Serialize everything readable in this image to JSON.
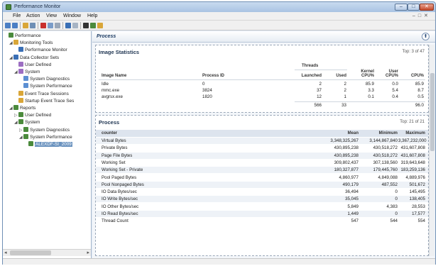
{
  "window": {
    "title": "Performance Monitor"
  },
  "menu": [
    "File",
    "Action",
    "View",
    "Window",
    "Help"
  ],
  "tree": [
    {
      "label": "Performance",
      "level": 0,
      "icon_color": "#4b8a3c",
      "toggle": ""
    },
    {
      "label": "Monitoring Tools",
      "level": 1,
      "icon_color": "#d9a638",
      "toggle": "◢"
    },
    {
      "label": "Performance Monitor",
      "level": 2,
      "icon_color": "#3a6fb5",
      "toggle": ""
    },
    {
      "label": "Data Collector Sets",
      "level": 1,
      "icon_color": "#3a6fb5",
      "toggle": "◢"
    },
    {
      "label": "User Defined",
      "level": 2,
      "icon_color": "#9c6ec2",
      "toggle": ""
    },
    {
      "label": "System",
      "level": 2,
      "icon_color": "#9c6ec2",
      "toggle": "◢"
    },
    {
      "label": "System Diagnostics",
      "level": 3,
      "icon_color": "#5c8fd2",
      "toggle": ""
    },
    {
      "label": "System Performance",
      "level": 3,
      "icon_color": "#5c8fd2",
      "toggle": ""
    },
    {
      "label": "Event Trace Sessions",
      "level": 2,
      "icon_color": "#d9a638",
      "toggle": ""
    },
    {
      "label": "Startup Event Trace Ses",
      "level": 2,
      "icon_color": "#d9a638",
      "toggle": ""
    },
    {
      "label": "Reports",
      "level": 1,
      "icon_color": "#4b8a3c",
      "toggle": "◢"
    },
    {
      "label": "User Defined",
      "level": 2,
      "icon_color": "#4b8a3c",
      "toggle": "▷"
    },
    {
      "label": "System",
      "level": 2,
      "icon_color": "#4b8a3c",
      "toggle": "◢"
    },
    {
      "label": "System Diagnostics",
      "level": 3,
      "icon_color": "#4b8a3c",
      "toggle": "▷"
    },
    {
      "label": "System Performance",
      "level": 3,
      "icon_color": "#4b8a3c",
      "toggle": "◢"
    },
    {
      "label": "ALEXDF-SI_2009",
      "level": 4,
      "icon_color": "#4b8a3c",
      "toggle": "",
      "selected": true
    }
  ],
  "panel": {
    "title": "Process",
    "collapse_glyph": "⬆"
  },
  "image_stats": {
    "title": "Image Statistics",
    "count": "Top: 3    of 47",
    "threads_group": "Threads",
    "headers": [
      "Image Name",
      "Process ID",
      "Launched",
      "Used",
      "Kernel CPU%",
      "User CPU%",
      "CPU%"
    ],
    "rows": [
      [
        "Idle",
        "0",
        "2",
        "2",
        "85.9",
        "0.0",
        "85.9"
      ],
      [
        "mmc.exe",
        "3824",
        "37",
        "2",
        "3.3",
        "5.4",
        "8.7"
      ],
      [
        "avgrsx.exe",
        "1820",
        "12",
        "1",
        "0.1",
        "0.4",
        "0.5"
      ]
    ],
    "totals": [
      "566",
      "33",
      "",
      "",
      "96.0"
    ]
  },
  "process": {
    "title": "Process",
    "count": "Top: 21    of 21",
    "headers": [
      "counter",
      "Mean",
      "Minimum",
      "Maximum"
    ],
    "rows": [
      [
        "Virtual Bytes",
        "3,348,325,267",
        "3,144,867,840",
        "3,367,232,000"
      ],
      [
        "Private Bytes",
        "430,895,238",
        "430,518,272",
        "431,607,808"
      ],
      [
        "Page File Bytes",
        "430,895,238",
        "430,518,272",
        "431,607,808"
      ],
      [
        "Working Set",
        "309,802,437",
        "307,138,560",
        "319,643,648"
      ],
      [
        "Working Set - Private",
        "180,327,877",
        "179,445,760",
        "183,259,136"
      ],
      [
        "Pool Paged Bytes",
        "4,860,977",
        "4,849,088",
        "4,889,976"
      ],
      [
        "Pool Nonpaged Bytes",
        "490,179",
        "487,552",
        "501,672"
      ],
      [
        "IO Data Bytes/sec",
        "36,494",
        "0",
        "145,495"
      ],
      [
        "IO Write Bytes/sec",
        "35,045",
        "0",
        "138,405"
      ],
      [
        "IO Other Bytes/sec",
        "5,849",
        "4,383",
        "28,553"
      ],
      [
        "IO Read Bytes/sec",
        "1,449",
        "0",
        "17,577"
      ],
      [
        "Thread Count",
        "547",
        "544",
        "554"
      ]
    ]
  }
}
